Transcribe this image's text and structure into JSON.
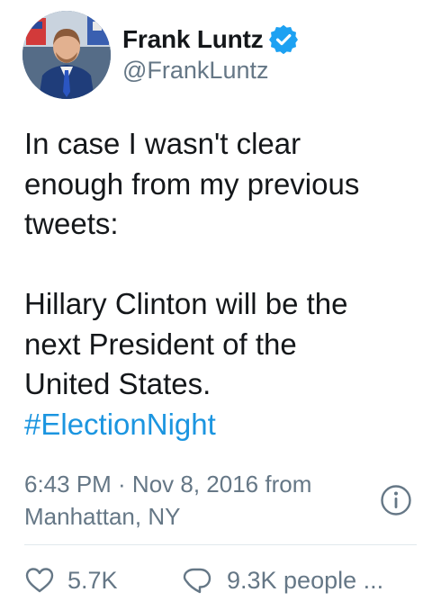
{
  "user": {
    "display_name": "Frank Luntz",
    "handle": "@FrankLuntz",
    "verified": true
  },
  "tweet": {
    "text_lines": [
      "In case I wasn't clear",
      "enough from my previous",
      "tweets:"
    ],
    "text_lines_2": [
      "Hillary Clinton will be the",
      "next President of the",
      "United States."
    ],
    "hashtag": "#ElectionNight",
    "timestamp_line": "6:43 PM · Nov 8, 2016 from",
    "location": "Manhattan, NY"
  },
  "actions": {
    "likes": "5.7K",
    "replies_label": "9.3K people ..."
  },
  "icons": {
    "verified": "verified-badge-icon",
    "info": "info-icon",
    "like": "heart-icon",
    "reply": "speech-bubble-icon"
  },
  "colors": {
    "link": "#1b95e0",
    "secondary_text": "#657786",
    "verified_badge": "#1da1f2"
  }
}
